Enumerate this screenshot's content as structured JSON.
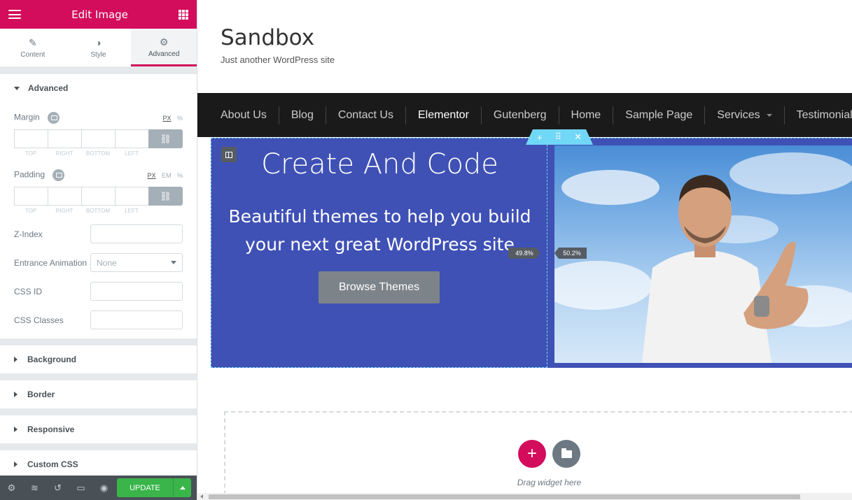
{
  "panel": {
    "title": "Edit Image",
    "tabs": [
      {
        "label": "Content",
        "icon": "pencil-icon"
      },
      {
        "label": "Style",
        "icon": "half-circle-icon"
      },
      {
        "label": "Advanced",
        "icon": "gear-icon"
      }
    ],
    "advanced_section": "Advanced",
    "margin": {
      "label": "Margin",
      "units": [
        "PX",
        "%"
      ],
      "selected_unit": "PX"
    },
    "padding": {
      "label": "Padding",
      "units": [
        "PX",
        "EM",
        "%"
      ],
      "selected_unit": "PX"
    },
    "dim_labels": [
      "TOP",
      "RIGHT",
      "BOTTOM",
      "LEFT"
    ],
    "z_index": {
      "label": "Z-Index",
      "value": ""
    },
    "entrance_animation": {
      "label": "Entrance Animation",
      "value": "None"
    },
    "css_id": {
      "label": "CSS ID",
      "value": ""
    },
    "css_classes": {
      "label": "CSS Classes",
      "value": ""
    },
    "collapsed_sections": [
      "Background",
      "Border",
      "Responsive",
      "Custom CSS"
    ],
    "footer": {
      "icons": [
        "settings-icon",
        "layers-icon",
        "history-icon",
        "responsive-icon",
        "preview-icon"
      ],
      "update_label": "UPDATE"
    }
  },
  "site": {
    "title": "Sandbox",
    "tagline": "Just another WordPress site",
    "nav": [
      "About Us",
      "Blog",
      "Contact Us",
      "Elementor",
      "Gutenberg",
      "Home",
      "Sample Page",
      "Services",
      "Testimonials"
    ],
    "nav_active": "Elementor"
  },
  "hero": {
    "heading": "Create And Code",
    "subheading": "Beautiful themes to help you build your next great WordPress site",
    "button": "Browse Themes",
    "left_width": "49.8%",
    "right_width": "50.2%"
  },
  "dropzone": {
    "add_label": "+",
    "text": "Drag widget here"
  },
  "colors": {
    "brand": "#d30c5c",
    "hero_bg": "#3f51b5",
    "nav_bg": "#1a1a1a",
    "update": "#39b54a",
    "handle": "#71d7f7"
  }
}
